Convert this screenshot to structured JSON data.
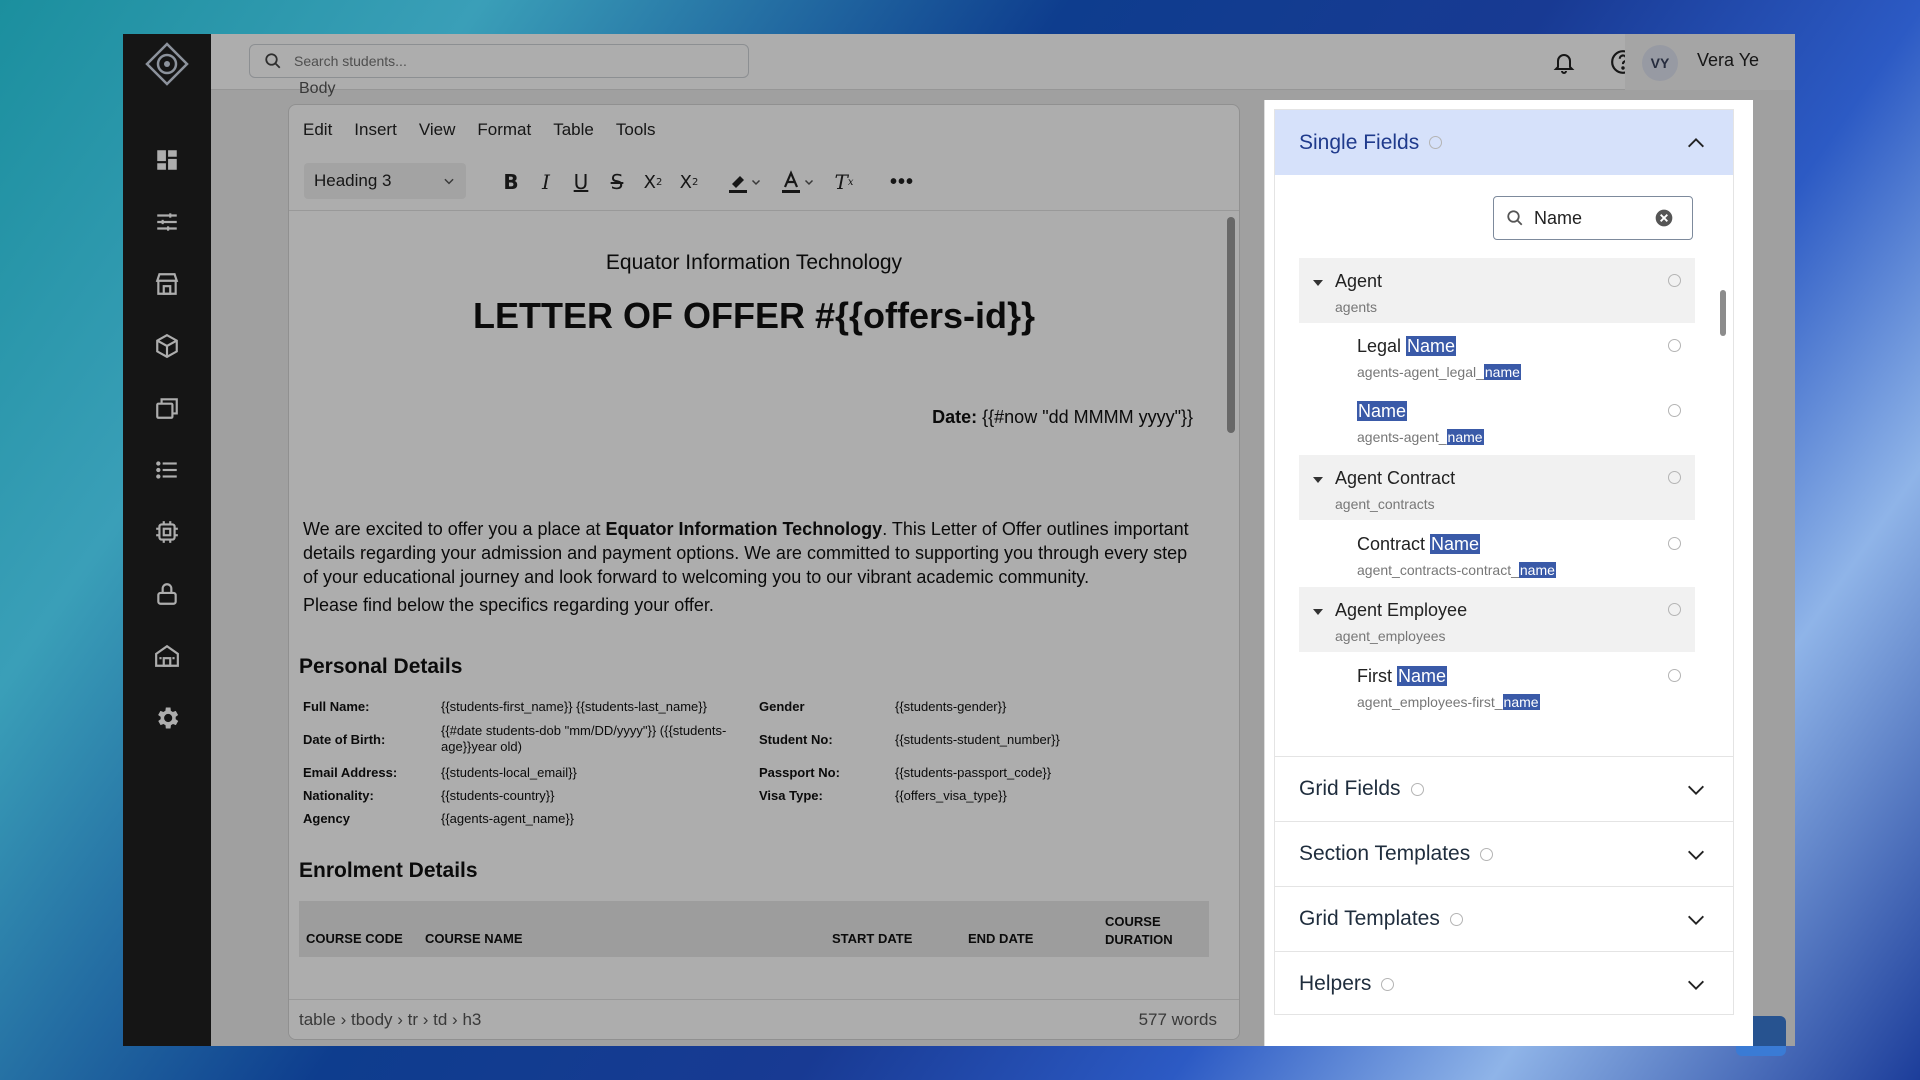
{
  "topbar": {
    "search_placeholder": "Search students...",
    "user_initials": "VY",
    "user_name": "Vera Ye"
  },
  "sidebar": {
    "items": [
      "dashboard-icon",
      "sliders-icon",
      "store-icon",
      "cube-icon",
      "layers-icon",
      "list-icon",
      "chip-icon",
      "lock-icon",
      "building-icon",
      "gear-icon"
    ]
  },
  "editor": {
    "body_label": "Body",
    "menu": [
      "Edit",
      "Insert",
      "View",
      "Format",
      "Table",
      "Tools"
    ],
    "block_format": "Heading 3",
    "document": {
      "company": "Equator Information Technology",
      "title": "LETTER OF OFFER #{{offers-id}}",
      "date_label": "Date:",
      "date_value": "{{#now \"dd MMMM yyyy\"}}",
      "intro_1": "We are excited to offer you a place at ",
      "intro_bold": "Equator Information Technology",
      "intro_2": ". This Letter of Offer outlines important details regarding your admission and payment options. We are committed to supporting you through every step of your educational journey and look forward to welcoming you to our vibrant academic community.",
      "intro_p2": "Please find below the specifics regarding your offer.",
      "personal_heading": "Personal Details",
      "personal": {
        "full_name_label": "Full Name:",
        "full_name_value": "{{students-first_name}} {{students-last_name}}",
        "gender_label": "Gender",
        "gender_value": "{{students-gender}}",
        "dob_label": "Date of Birth:",
        "dob_value": "{{#date students-dob \"mm/DD/yyyy\"}} ({{students-age}}year old)",
        "student_no_label": "Student No:",
        "student_no_value": "{{students-student_number}}",
        "email_label": "Email Address:",
        "email_value": "{{students-local_email}}",
        "passport_label": "Passport No:",
        "passport_value": "{{students-passport_code}}",
        "nationality_label": "Nationality:",
        "nationality_value": "{{students-country}}",
        "visa_label": "Visa Type:",
        "visa_value": "{{offers_visa_type}}",
        "agency_label": "Agency",
        "agency_value": "{{agents-agent_name}}"
      },
      "enrolment_heading": "Enrolment Details",
      "enrolment_columns": [
        "COURSE CODE",
        "COURSE NAME",
        "START DATE",
        "END DATE",
        "COURSE DURATION"
      ]
    },
    "status_path": "table › tbody › tr › td › h3",
    "word_count": "577 words"
  },
  "panel": {
    "single_fields": "Single Fields",
    "search_value": "Name",
    "tree": [
      {
        "type": "group",
        "title": "Agent",
        "sub": "agents"
      },
      {
        "type": "field",
        "title_pre": "Legal ",
        "title_hl": "Name",
        "sub_pre": "agents-agent_legal_",
        "sub_hl": "name"
      },
      {
        "type": "field",
        "title_pre": "",
        "title_hl": "Name",
        "sub_pre": "agents-agent_",
        "sub_hl": "name"
      },
      {
        "type": "group",
        "title": "Agent Contract",
        "sub": "agent_contracts"
      },
      {
        "type": "field",
        "title_pre": "Contract ",
        "title_hl": "Name",
        "sub_pre": "agent_contracts-contract_",
        "sub_hl": "name"
      },
      {
        "type": "group",
        "title": "Agent Employee",
        "sub": "agent_employees"
      },
      {
        "type": "field",
        "title_pre": "First ",
        "title_hl": "Name",
        "sub_pre": "agent_employees-first_",
        "sub_hl": "name"
      }
    ],
    "sections": [
      "Grid Fields",
      "Section Templates",
      "Grid Templates",
      "Helpers"
    ]
  }
}
